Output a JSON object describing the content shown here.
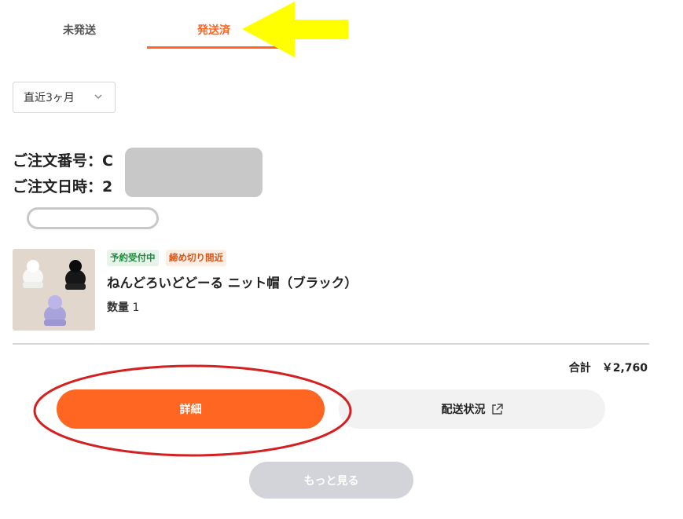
{
  "tabs": {
    "unsent": "未発送",
    "sent": "発送済"
  },
  "filter": {
    "period": "直近3ヶ月"
  },
  "order": {
    "number_label": "ご注文番号：",
    "number_visible": "C",
    "date_label": "ご注文日時：",
    "date_visible": "2"
  },
  "product": {
    "badges": [
      "予約受付中",
      "締め切り間近"
    ],
    "name": "ねんどろいどどーる ニット帽（ブラック）",
    "quantity_label": "数量",
    "quantity": "1",
    "image_icon": "knit-hat-product-image"
  },
  "summary": {
    "total_label": "合計",
    "total_value": "￥2,760"
  },
  "actions": {
    "detail": "詳細",
    "shipping_status": "配送状況",
    "shipping_icon": "external-link-icon",
    "more": "もっと見る"
  },
  "colors": {
    "accent": "#ff6622",
    "annotation_arrow": "#ffff00",
    "annotation_circle": "#d42020"
  }
}
